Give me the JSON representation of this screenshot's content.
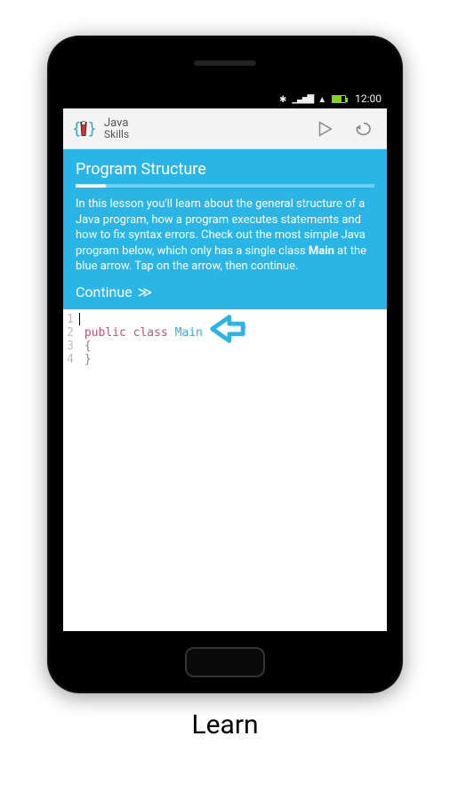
{
  "statusbar": {
    "time": "12:00"
  },
  "actionbar": {
    "title_line1": "Java",
    "title_line2": "Skills"
  },
  "lesson": {
    "title": "Program Structure",
    "body_pre": "In this lesson you'll learn about the general structure of a Java program, how a program executes statements and how to fix syntax errors. Check out the most simple Java program below, which only has a single class ",
    "body_bold": "Main",
    "body_post": " at the blue arrow. Tap on the arrow, then continue.",
    "continue_label": "Continue",
    "continue_glyph": "≫"
  },
  "code": {
    "lines": [
      {
        "n": "1",
        "pre": "",
        "kw": "",
        "id": "",
        "post": ""
      },
      {
        "n": "2",
        "pre": "",
        "kw": "public class ",
        "id": "Main",
        "post": ""
      },
      {
        "n": "3",
        "pre": "{",
        "kw": "",
        "id": "",
        "post": ""
      },
      {
        "n": "4",
        "pre": "}",
        "kw": "",
        "id": "",
        "post": ""
      }
    ]
  },
  "caption": "Learn"
}
